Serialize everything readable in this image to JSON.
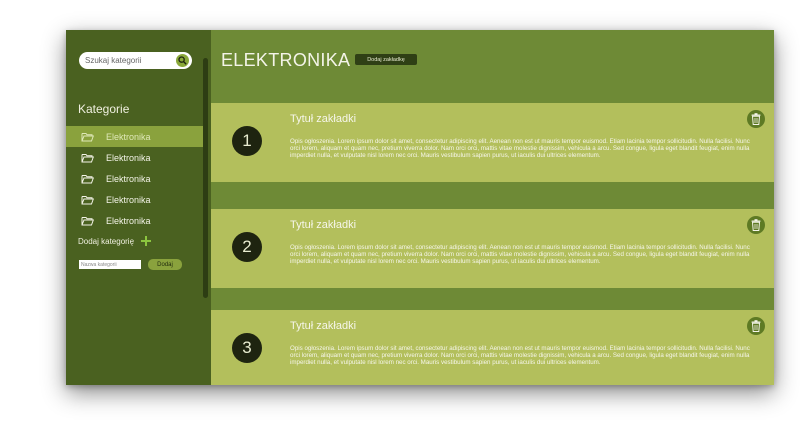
{
  "sidebar": {
    "search_placeholder": "Szukaj kategorii",
    "title": "Kategorie",
    "categories": [
      {
        "label": "Elektronika",
        "active": true
      },
      {
        "label": "Elektronika",
        "active": false
      },
      {
        "label": "Elektronika",
        "active": false
      },
      {
        "label": "Elektronika",
        "active": false
      },
      {
        "label": "Elektronika",
        "active": false
      }
    ],
    "add_category_label": "Dodaj kategorię",
    "new_category_placeholder": "Nazwa kategorii",
    "add_button_label": "Dodaj"
  },
  "header": {
    "title": "ELEKTRONIKA",
    "add_tab_button": "Dodaj zakładkę"
  },
  "cards": [
    {
      "number": "1",
      "title": "Tytuł zakładki",
      "description": "Opis ogłoszenia. Lorem ipsum dolor sit amet, consectetur adipiscing elit. Aenean non est ut mauris tempor euismod. Etiam lacinia tempor sollicitudin. Nulla facilisi. Nunc orci lorem, aliquam et quam nec, pretium viverra dolor. Nam orci orci, mattis vitae molestie dignissim, vehicula a arcu. Sed congue, ligula eget blandit feugiat, enim nulla imperdiet nulla, et vulputate nisl lorem nec orci. Mauris vestibulum sapien purus, ut iaculis dui ultrices elementum."
    },
    {
      "number": "2",
      "title": "Tytuł zakładki",
      "description": "Opis ogłoszenia. Lorem ipsum dolor sit amet, consectetur adipiscing elit. Aenean non est ut mauris tempor euismod. Etiam lacinia tempor sollicitudin. Nulla facilisi. Nunc orci lorem, aliquam et quam nec, pretium viverra dolor. Nam orci orci, mattis vitae molestie dignissim, vehicula a arcu. Sed congue, ligula eget blandit feugiat, enim nulla imperdiet nulla, et vulputate nisl lorem nec orci. Mauris vestibulum sapien purus, ut iaculis dui ultrices elementum."
    },
    {
      "number": "3",
      "title": "Tytuł zakładki",
      "description": "Opis ogłoszenia. Lorem ipsum dolor sit amet, consectetur adipiscing elit. Aenean non est ut mauris tempor euismod. Etiam lacinia tempor sollicitudin. Nulla facilisi. Nunc orci lorem, aliquam et quam nec, pretium viverra dolor. Nam orci orci, mattis vitae molestie dignissim, vehicula a arcu. Sed congue, ligula eget blandit feugiat, enim nulla imperdiet nulla, et vulputate nisl lorem nec orci. Mauris vestibulum sapien purus, ut iaculis dui ultrices elementum."
    }
  ],
  "icons": {
    "search": "search-icon",
    "folder": "folder-icon",
    "plus": "plus-icon",
    "delete": "trash-icon"
  },
  "colors": {
    "background": "#6e8a36",
    "sidebar": "#4a6120",
    "active_item": "#8aa23d",
    "card": "#b3bf5c",
    "number_badge": "#1e2410",
    "delete_button": "#5e7a24",
    "accent_plus": "#8cc63f"
  }
}
